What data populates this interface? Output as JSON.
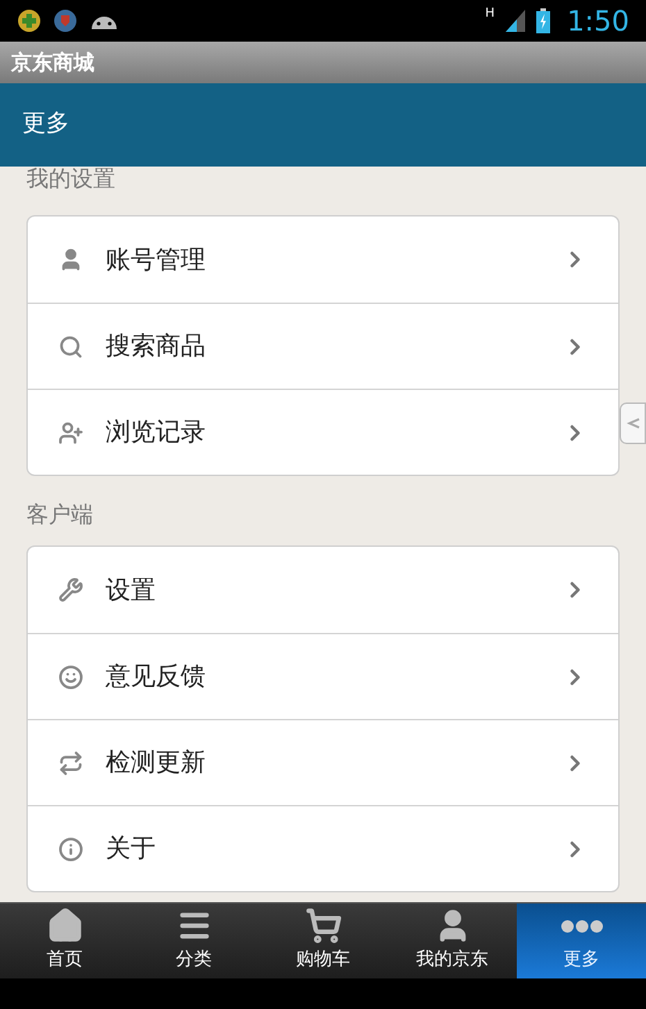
{
  "status_bar": {
    "network": "H",
    "time": "1:50"
  },
  "window": {
    "title": "京东商城"
  },
  "header": {
    "title": "更多"
  },
  "sections": [
    {
      "title": "我的设置",
      "items": [
        {
          "label": "账号管理"
        },
        {
          "label": "搜索商品"
        },
        {
          "label": "浏览记录"
        }
      ]
    },
    {
      "title": "客户端",
      "items": [
        {
          "label": "设置"
        },
        {
          "label": "意见反馈"
        },
        {
          "label": "检测更新"
        },
        {
          "label": "关于"
        }
      ]
    }
  ],
  "tabs": [
    {
      "label": "首页",
      "selected": false
    },
    {
      "label": "分类",
      "selected": false
    },
    {
      "label": "购物车",
      "selected": false
    },
    {
      "label": "我的京东",
      "selected": false
    },
    {
      "label": "更多",
      "selected": true
    }
  ]
}
